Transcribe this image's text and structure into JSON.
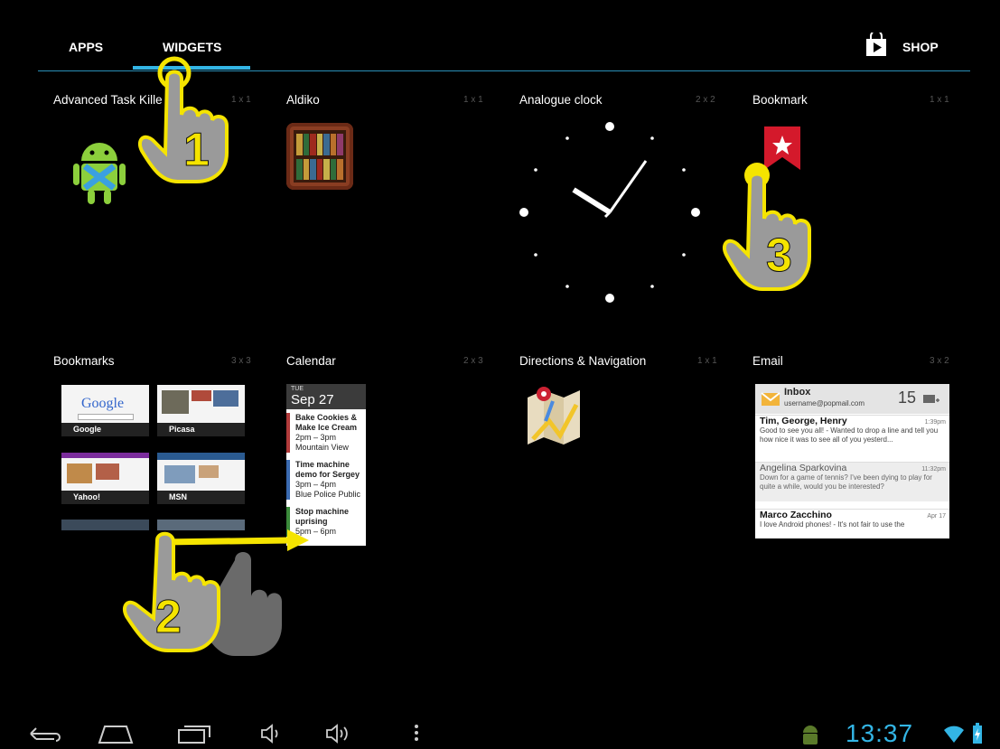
{
  "tabs": {
    "apps": "APPS",
    "widgets": "WIDGETS",
    "shop": "SHOP"
  },
  "widgets": [
    {
      "name": "Advanced Task Kille",
      "size": "1 x 1"
    },
    {
      "name": "Aldiko",
      "size": "1 x 1"
    },
    {
      "name": "Analogue clock",
      "size": "2 x 2"
    },
    {
      "name": "Bookmark",
      "size": "1 x 1"
    },
    {
      "name": "Bookmarks",
      "size": "3 x 3"
    },
    {
      "name": "Calendar",
      "size": "2 x 3"
    },
    {
      "name": "Directions & Navigation",
      "size": "1 x 1"
    },
    {
      "name": "Email",
      "size": "3 x 2"
    }
  ],
  "bookmarks": {
    "google": "Google",
    "picasa": "Picasa",
    "yahoo": "Yahoo!",
    "msn": "MSN",
    "google_logo": "Google"
  },
  "calendar": {
    "day": "TUE",
    "date": "Sep 27",
    "events": [
      {
        "title": "Bake Cookies & Make Ice Cream",
        "time": "2pm – 3pm",
        "place": "Mountain View"
      },
      {
        "title": "Time machine demo for Sergey",
        "time": "3pm – 4pm",
        "place": "Blue Police Public"
      },
      {
        "title": "Stop machine uprising",
        "time": "5pm – 6pm",
        "place": ""
      }
    ]
  },
  "email": {
    "title": "Inbox",
    "account": "username@popmail.com",
    "count": "15",
    "messages": [
      {
        "from": "Tim, George, Henry",
        "time": "1:39pm",
        "snippet": "Good to see you all! - Wanted to drop a line and tell you how nice it was to see all of you yesterd..."
      },
      {
        "from": "Angelina Sparkovina",
        "time": "11:32pm",
        "snippet": "Down for a game of tennis? I've been dying to play for quite a while, would you be interested?"
      },
      {
        "from": "Marco Zacchino",
        "time": "Apr 17",
        "snippet": "I love Android phones! - It's not fair to use the"
      }
    ]
  },
  "annotations": {
    "step1": "1",
    "step2": "2",
    "step3": "3"
  },
  "status": {
    "time": "13:37"
  },
  "colors": {
    "accent": "#33b5e5",
    "highlight": "#f5e400",
    "hand": "#9a9a9a"
  }
}
